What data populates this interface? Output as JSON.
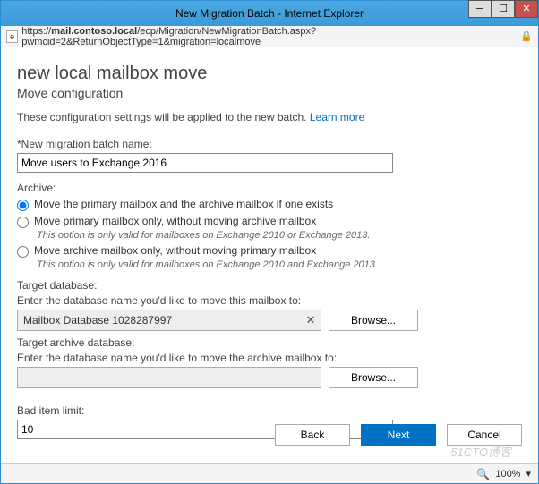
{
  "window": {
    "title": "New Migration Batch - Internet Explorer",
    "url_prefix": "https://",
    "url_host": "mail.contoso.local",
    "url_path": "/ecp/Migration/NewMigrationBatch.aspx?pwmcid=2&ReturnObjectType=1&migration=localmove"
  },
  "page": {
    "heading": "new local mailbox move",
    "subheading": "Move configuration",
    "intro_text": "These configuration settings will be applied to the new batch. ",
    "learn_more": "Learn more"
  },
  "batch": {
    "label": "*New migration batch name:",
    "value": "Move users to Exchange 2016"
  },
  "archive": {
    "label": "Archive:",
    "opt1": "Move the primary mailbox and the archive mailbox if one exists",
    "opt2": "Move primary mailbox only, without moving archive mailbox",
    "opt2_note": "This option is only valid for mailboxes on Exchange 2010 or Exchange 2013.",
    "opt3": "Move archive mailbox only, without moving primary mailbox",
    "opt3_note": "This option is only valid for mailboxes on Exchange 2010 and Exchange 2013."
  },
  "target_db": {
    "label": "Target database:",
    "hint": "Enter the database name you'd like to move this mailbox to:",
    "value": "Mailbox Database 1028287997",
    "browse": "Browse..."
  },
  "target_archive": {
    "label": "Target archive database:",
    "hint": "Enter the database name you'd like to move the archive mailbox to:",
    "value": "",
    "browse": "Browse..."
  },
  "bad_limit": {
    "label": "Bad item limit:",
    "value": "10"
  },
  "nav": {
    "back": "Back",
    "next": "Next",
    "cancel": "Cancel"
  },
  "status": {
    "zoom": "100%"
  },
  "watermark": "51CTO博客"
}
